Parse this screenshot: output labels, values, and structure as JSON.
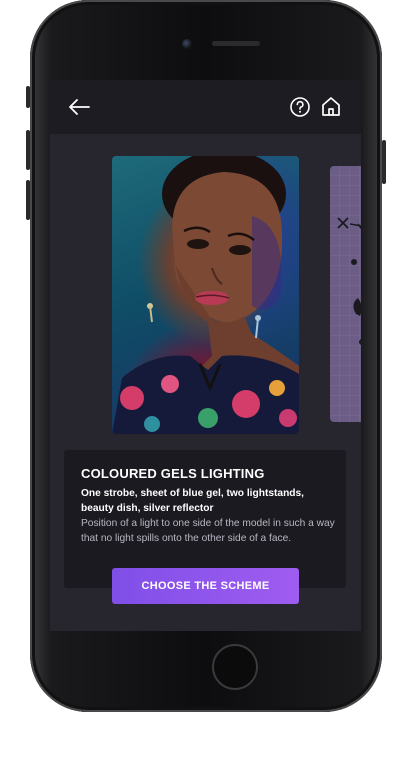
{
  "header": {
    "back_icon": "arrow-left-icon",
    "help_icon": "question-circle-icon",
    "home_icon": "home-icon"
  },
  "scheme": {
    "title": "COLOURED GELS LIGHTING",
    "equipment": "One strobe, sheet of blue gel, two lightstands, beauty dish, silver reflector",
    "description": "Position of a light to one side of the model in such a way that no light spills onto the other side of a face."
  },
  "actions": {
    "choose_label": "CHOOSE THE SCHEME"
  },
  "colors": {
    "screen_bg": "#27262f",
    "topbar_bg": "#1d1c22",
    "panel_bg": "#1b1a20",
    "accent": "#8b55ec",
    "peek_card": "#6b5d86"
  }
}
